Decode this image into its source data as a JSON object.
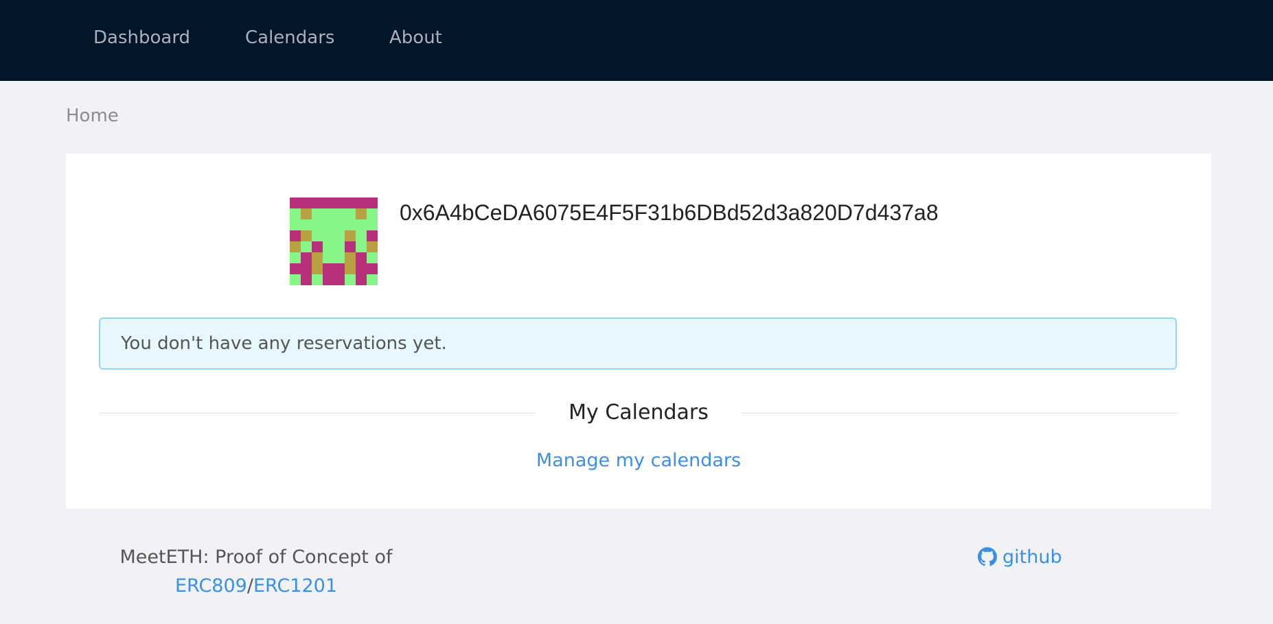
{
  "nav": {
    "items": [
      {
        "label": "Dashboard"
      },
      {
        "label": "Calendars"
      },
      {
        "label": "About"
      }
    ]
  },
  "breadcrumb": {
    "label": "Home"
  },
  "profile": {
    "address": "0x6A4bCeDA6075E4F5F31b6DBd52d3a820D7d437a8",
    "avatar_icon": "blockie-identicon"
  },
  "alert": {
    "text": "You don't have any reservations yet."
  },
  "section": {
    "title": "My Calendars"
  },
  "manage_link": "Manage my calendars",
  "footer": {
    "text": "MeetETH: Proof of Concept of",
    "link1": "ERC809",
    "separator": "/",
    "link2": "ERC1201",
    "github_label": "github",
    "github_icon": "github-icon"
  },
  "colors": {
    "header_bg": "#021529",
    "link": "#3a8fe6",
    "alert_bg": "#e6f7fe",
    "alert_border": "#91d5fb",
    "avatar_pink": "#b8307a",
    "avatar_green": "#88f588",
    "avatar_gold": "#b89f42"
  }
}
